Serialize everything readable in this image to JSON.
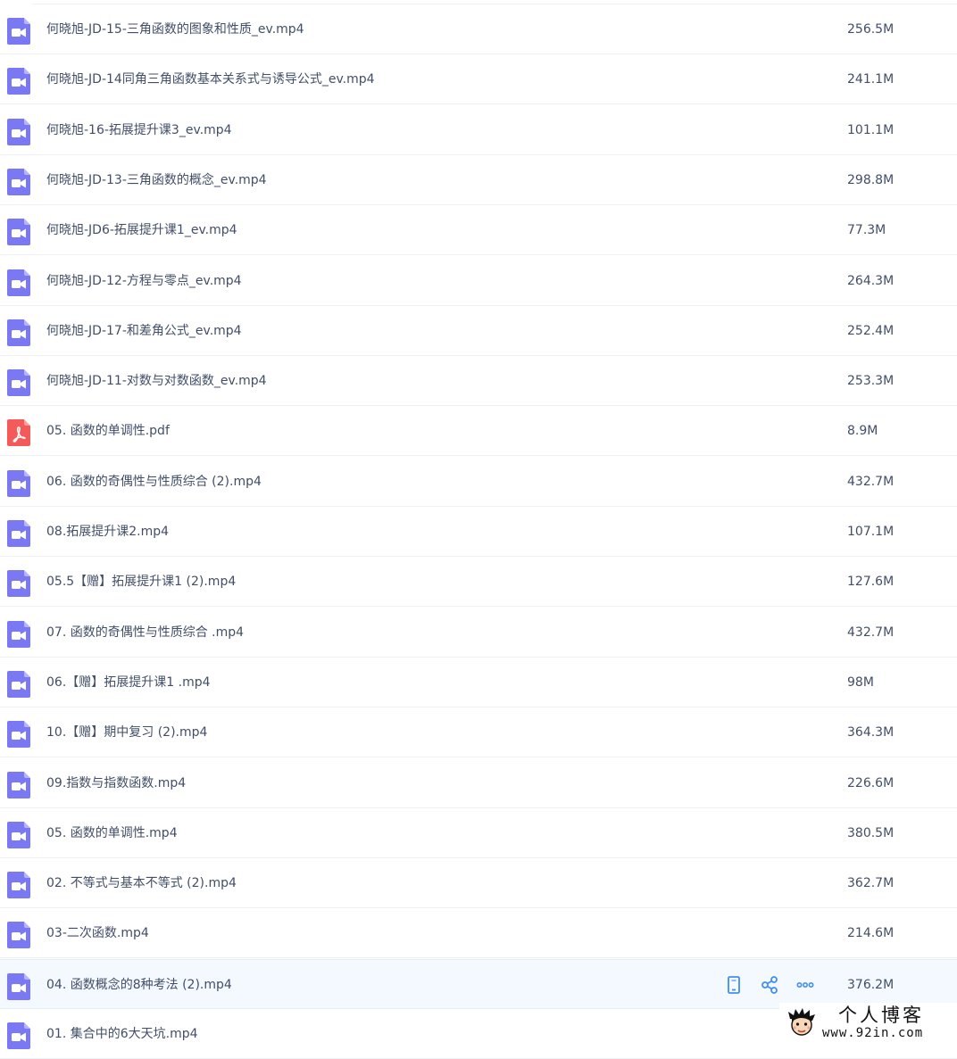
{
  "icons": {
    "video": {
      "name": "video-file-icon",
      "color": "#7b78f4"
    },
    "pdf": {
      "name": "pdf-file-icon",
      "color": "#f45a57"
    }
  },
  "files": [
    {
      "name": "何晓旭-JD-15-三角函数的图象和性质_ev.mp4",
      "size": "256.5M",
      "type": "video"
    },
    {
      "name": "何晓旭-JD-14同角三角函数基本关系式与诱导公式_ev.mp4",
      "size": "241.1M",
      "type": "video"
    },
    {
      "name": "何晓旭-16-拓展提升课3_ev.mp4",
      "size": "101.1M",
      "type": "video"
    },
    {
      "name": "何晓旭-JD-13-三角函数的概念_ev.mp4",
      "size": "298.8M",
      "type": "video"
    },
    {
      "name": "何晓旭-JD6-拓展提升课1_ev.mp4",
      "size": "77.3M",
      "type": "video"
    },
    {
      "name": "何晓旭-JD-12-方程与零点_ev.mp4",
      "size": "264.3M",
      "type": "video"
    },
    {
      "name": "何晓旭-JD-17-和差角公式_ev.mp4",
      "size": "252.4M",
      "type": "video"
    },
    {
      "name": "何晓旭-JD-11-对数与对数函数_ev.mp4",
      "size": "253.3M",
      "type": "video"
    },
    {
      "name": "05. 函数的单调性.pdf",
      "size": "8.9M",
      "type": "pdf"
    },
    {
      "name": "06. 函数的奇偶性与性质综合 (2).mp4",
      "size": "432.7M",
      "type": "video"
    },
    {
      "name": "08.拓展提升课2.mp4",
      "size": "107.1M",
      "type": "video"
    },
    {
      "name": "05.5【赠】拓展提升课1 (2).mp4",
      "size": "127.6M",
      "type": "video"
    },
    {
      "name": "07. 函数的奇偶性与性质综合 .mp4",
      "size": "432.7M",
      "type": "video"
    },
    {
      "name": "06.【赠】拓展提升课1 .mp4",
      "size": "98M",
      "type": "video"
    },
    {
      "name": "10.【赠】期中复习 (2).mp4",
      "size": "364.3M",
      "type": "video"
    },
    {
      "name": "09.指数与指数函数.mp4",
      "size": "226.6M",
      "type": "video"
    },
    {
      "name": "05. 函数的单调性.mp4",
      "size": "380.5M",
      "type": "video"
    },
    {
      "name": "02. 不等式与基本不等式 (2).mp4",
      "size": "362.7M",
      "type": "video"
    },
    {
      "name": "03-二次函数.mp4",
      "size": "214.6M",
      "type": "video"
    },
    {
      "name": "04. 函数概念的8种考法 (2).mp4",
      "size": "376.2M",
      "type": "video",
      "hovered": true
    },
    {
      "name": "01. 集合中的6大天坑.mp4",
      "size": "",
      "type": "video"
    }
  ],
  "row_actions": [
    {
      "name": "phone-icon",
      "label": "send to phone"
    },
    {
      "name": "share-icon",
      "label": "share"
    },
    {
      "name": "more-icon",
      "label": "more"
    }
  ],
  "accent_color": "#3f8ef5",
  "hover_color": "#f4f9ff",
  "watermark": {
    "title": "个人博客",
    "url": "www.92in.com"
  }
}
